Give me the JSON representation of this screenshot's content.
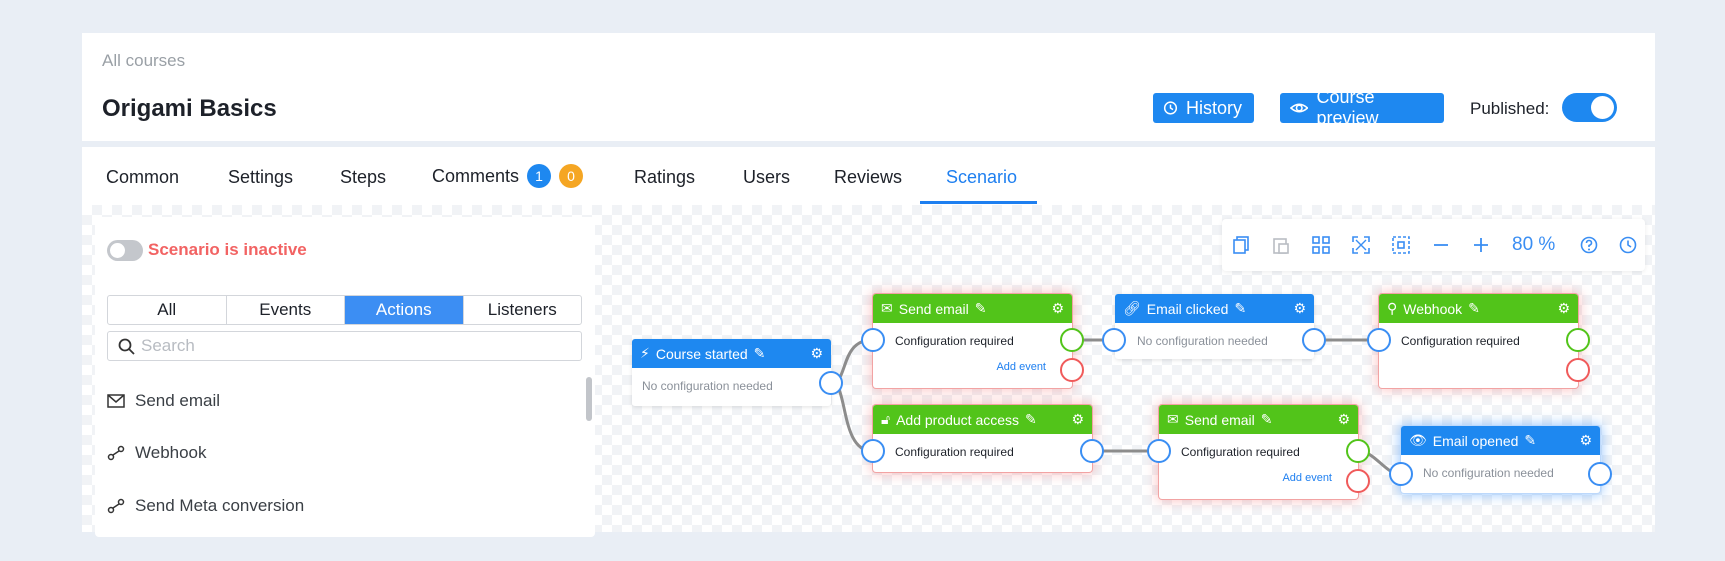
{
  "header": {
    "breadcrumb": "All courses",
    "title": "Origami Basics",
    "history_label": "History",
    "preview_label": "Course preview",
    "published_label": "Published:",
    "published": true
  },
  "tabs": {
    "common": "Common",
    "settings": "Settings",
    "steps": "Steps",
    "comments": "Comments",
    "comments_badge_blue": "1",
    "comments_badge_orange": "0",
    "ratings": "Ratings",
    "users": "Users",
    "reviews": "Reviews",
    "scenario": "Scenario",
    "active": "Scenario"
  },
  "panel": {
    "status_label": "Scenario is inactive",
    "filters": [
      "All",
      "Events",
      "Actions",
      "Listeners"
    ],
    "active_filter": "Actions",
    "search_placeholder": "Search",
    "items": [
      {
        "label": "Send email",
        "icon": "mail-icon"
      },
      {
        "label": "Webhook",
        "icon": "webhook-icon"
      },
      {
        "label": "Send Meta conversion",
        "icon": "webhook-icon"
      }
    ]
  },
  "toolbar": {
    "zoom": "80 %",
    "icons": [
      "copy-icon",
      "paste-icon",
      "grid-icon",
      "fit-screen-icon",
      "select-area-icon",
      "zoom-out-icon",
      "zoom-in-icon",
      "help-icon",
      "history-icon"
    ]
  },
  "nodes": {
    "course_started": {
      "title": "Course started",
      "body": "No configuration needed"
    },
    "send_email_1": {
      "title": "Send email",
      "body": "Configuration required",
      "add_event": "Add event"
    },
    "email_clicked": {
      "title": "Email clicked",
      "body": "No configuration needed"
    },
    "webhook": {
      "title": "Webhook",
      "body": "Configuration required"
    },
    "add_product_access": {
      "title": "Add product access",
      "body": "Configuration required"
    },
    "send_email_2": {
      "title": "Send email",
      "body": "Configuration required",
      "add_event": "Add event"
    },
    "email_opened": {
      "title": "Email opened",
      "body": "No configuration needed"
    }
  },
  "colors": {
    "accent": "#1e88f0",
    "action_green": "#52c41a",
    "error_red": "#f05a5a",
    "badge_orange": "#f5a623"
  }
}
